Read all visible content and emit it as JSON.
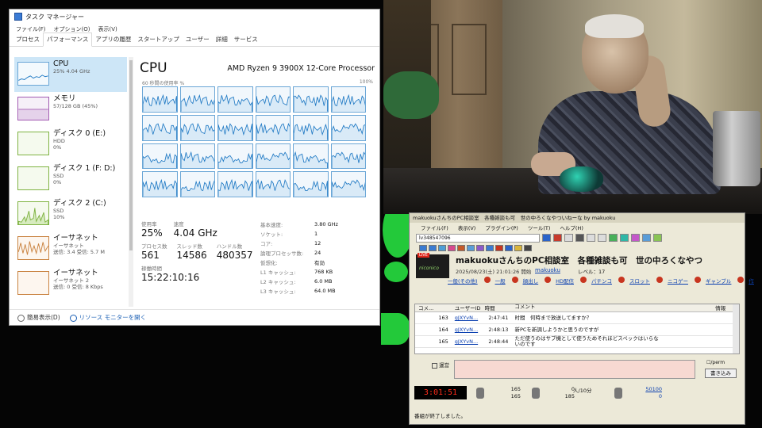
{
  "task_manager": {
    "title": "タスク マネージャー",
    "menu": [
      "ファイル(F)",
      "オプション(O)",
      "表示(V)"
    ],
    "tabs": [
      "プロセス",
      "パフォーマンス",
      "アプリの履歴",
      "スタートアップ",
      "ユーザー",
      "詳細",
      "サービス"
    ],
    "sidebar": [
      {
        "name": "CPU",
        "sub1": "25%  4.04 GHz",
        "sub2": ""
      },
      {
        "name": "メモリ",
        "sub1": "57/128 GB (45%)",
        "sub2": ""
      },
      {
        "name": "ディスク 0 (E:)",
        "sub1": "HDD",
        "sub2": "0%"
      },
      {
        "name": "ディスク 1 (F: D:)",
        "sub1": "SSD",
        "sub2": "0%"
      },
      {
        "name": "ディスク 2 (C:)",
        "sub1": "SSD",
        "sub2": "10%"
      },
      {
        "name": "イーサネット",
        "sub1": "イーサネット",
        "sub2": "送信: 3.4 受信: 5.7 M"
      },
      {
        "name": "イーサネット",
        "sub1": "イーサネット 2",
        "sub2": "送信: 0 受信: 8 Kbps"
      }
    ],
    "cpu": {
      "title": "CPU",
      "processor": "AMD Ryzen 9 3900X 12-Core Processor",
      "graph_label": "60 秒間の使用率 %",
      "graph_max": "100%",
      "util_label": "使用率",
      "util": "25%",
      "speed_label": "速度",
      "speed": "4.04 GHz",
      "procs_label": "プロセス数",
      "procs": "561",
      "threads_label": "スレッド数",
      "threads": "14586",
      "handles_label": "ハンドル数",
      "handles": "480357",
      "uptime_label": "稼働時間",
      "uptime": "15:22:10:16",
      "specs": [
        {
          "k": "基本速度:",
          "v": "3.80 GHz"
        },
        {
          "k": "ソケット:",
          "v": "1"
        },
        {
          "k": "コア:",
          "v": "12"
        },
        {
          "k": "論理プロセッサ数:",
          "v": "24"
        },
        {
          "k": "仮想化:",
          "v": "有効"
        },
        {
          "k": "L1 キャッシュ:",
          "v": "768 KB"
        },
        {
          "k": "L2 キャッシュ:",
          "v": "6.0 MB"
        },
        {
          "k": "L3 キャッシュ:",
          "v": "64.0 MB"
        }
      ]
    },
    "footer": {
      "less": "簡易表示(D)",
      "monitor": "リソース モニターを開く"
    }
  },
  "viewer": {
    "title": "makuokuさんちのPC相談室　各種雑談も可　世の中ろくなやついねーな by makuoku",
    "menu": [
      "ファイル(F)",
      "表示(V)",
      "プラグイン(P)",
      "ツール(T)",
      "ヘルプ(H)"
    ],
    "lv": "lv348547096",
    "live_badge": "LIVE",
    "logo": "niconico",
    "program_title": "makuokuさんちのPC相談室　各種雑談も可　世の中ろくなやつ",
    "date": "2025/08/23(土) 21:01:26 開始",
    "user": "makuoku",
    "level": "レベル：17",
    "tags": [
      "一般(その他)",
      "一般",
      "顔出し",
      "HD配信",
      "パチンコ",
      "スロット",
      "ニコゲー",
      "ギャンブル",
      "作"
    ],
    "columns": [
      "コメ...",
      "ユーザーID",
      "時間",
      "コメント",
      "",
      "",
      "",
      "情報"
    ],
    "rows": [
      {
        "no": "163",
        "id": "gJXYvN...",
        "time": "2:47:41",
        "text": "时間　何時まで放送してますか？"
      },
      {
        "no": "164",
        "id": "gJXYvN...",
        "time": "2:48:13",
        "text": "新PCを新調しようかと思うのですが"
      },
      {
        "no": "165",
        "id": "gJXYvN...",
        "time": "2:48:44",
        "text": "ただ使うのはサブ機として使うためそれほどスペックはいらないのです"
      }
    ],
    "checkbox_label": "運営",
    "perm_label": "/perm",
    "send_label": "書き込み",
    "timer": "3:01:51",
    "stats": {
      "a1": "165",
      "a2": "165",
      "b1": "0",
      "b2": "185",
      "b_unit": "人/10分",
      "c1": "50100",
      "c2": "0"
    },
    "status": "番組が終了しました。"
  },
  "colors": {
    "cpu_line": "#1f79c4",
    "mem": "#a25ab2",
    "disk": "#7fb342",
    "eth": "#c9823f",
    "timer": "#ff2b1a",
    "green_bg": "#23c93a"
  }
}
